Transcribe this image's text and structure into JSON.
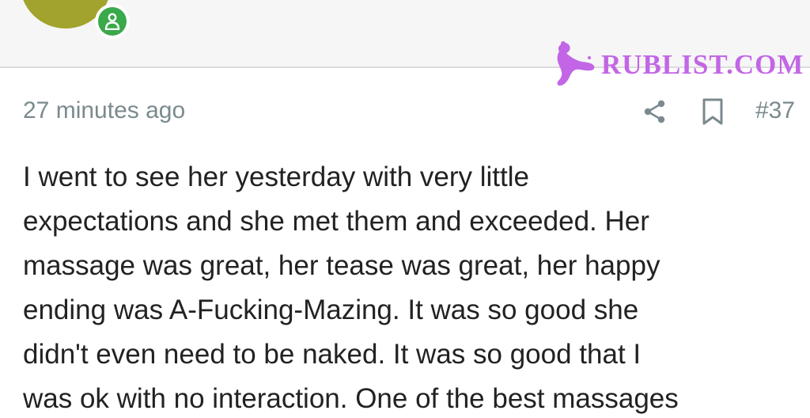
{
  "watermark": {
    "text": "RUBLIST.COM",
    "color": "#c266e6"
  },
  "author": {
    "avatar_color": "#a1a32c",
    "status_icon": "person-icon",
    "status_color": "#39a94a"
  },
  "post": {
    "timestamp": "27 minutes ago",
    "number": "#37",
    "actions": {
      "share_icon": "share-icon",
      "bookmark_icon": "bookmark-icon"
    },
    "body_lines": [
      "I went to see her yesterday with very little",
      "expectations and she met them and exceeded. Her",
      "massage was great, her tease was great, her happy",
      "ending was A-Fucking-Mazing. It was so good she",
      "didn't even need to be naked. It was so good that I",
      "was ok with no interaction. One of the best massages"
    ]
  }
}
